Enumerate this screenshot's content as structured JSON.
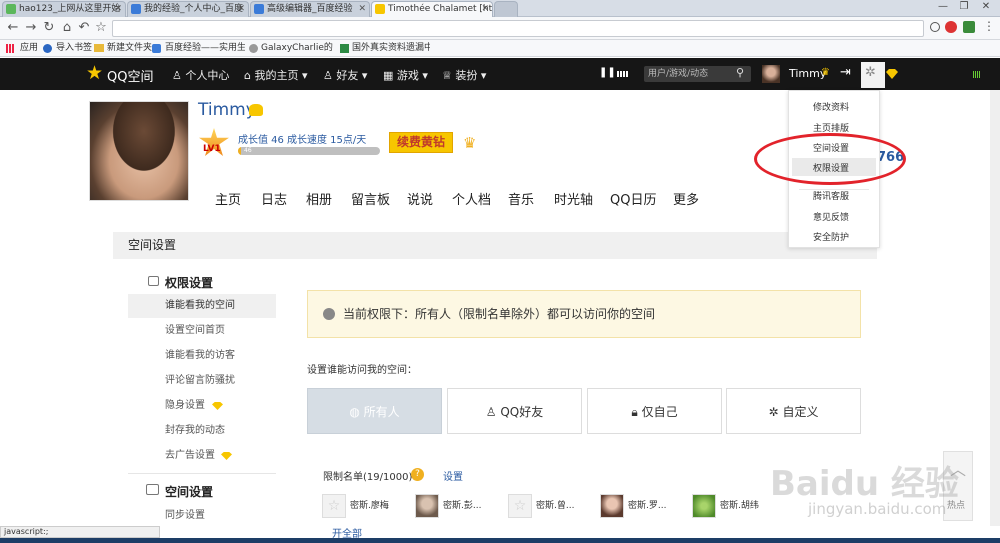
{
  "browser": {
    "tabs": [
      {
        "title": "hao123_上网从这里开始"
      },
      {
        "title": "我的经验_个人中心_百度"
      },
      {
        "title": "高级编辑器_百度经验"
      },
      {
        "title": "Timothée Chalamet [htt"
      }
    ],
    "window_controls": [
      "—",
      "❐",
      "✕"
    ],
    "nav": {
      "back": "←",
      "forward": "→",
      "reload": "↻",
      "home": "⌂",
      "undo": "↶",
      "star": "☆"
    },
    "bookmarks": [
      {
        "label": "应用"
      },
      {
        "label": "导入书签"
      },
      {
        "label": "新建文件夹"
      },
      {
        "label": "百度经验——实用生"
      },
      {
        "label": "GalaxyCharlie的个人"
      },
      {
        "label": "国外真实资料遗漏中"
      }
    ],
    "status_text": "javascript:;"
  },
  "qq": {
    "logo_text": "QQ空间",
    "nav": [
      {
        "label": "个人中心"
      },
      {
        "label": "我的主页"
      },
      {
        "label": "好友"
      },
      {
        "label": "游戏"
      },
      {
        "label": "装扮"
      }
    ],
    "search_placeholder": "用户/游戏/动态",
    "username": "Timmy",
    "accent": "#f7c600"
  },
  "profile": {
    "name": "Timmy",
    "level": "LV1",
    "growth": "成长值 46",
    "speed": "成长速度 15点/天",
    "progress_text": "46",
    "progress": 0.02,
    "vip_button": "续费黄钻",
    "visitor_count": "766"
  },
  "subnav": [
    "主页",
    "日志",
    "相册",
    "留言板",
    "说说",
    "个人档",
    "音乐",
    "时光轴",
    "QQ日历",
    "更多"
  ],
  "dropdown": [
    "修改资料",
    "主页排版",
    "空间设置",
    "权限设置",
    "腾讯客服",
    "意见反馈",
    "安全防护"
  ],
  "settings": {
    "header": "空间设置",
    "section1": "权限设置",
    "side_items": [
      "谁能看我的空间",
      "设置空间首页",
      "谁能看我的访客",
      "评论留言防骚扰",
      "隐身设置",
      "封存我的动态",
      "去广告设置"
    ],
    "section2": "空间设置",
    "side_items2": [
      "同步设置"
    ],
    "notice": "当前权限下：所有人（限制名单除外）都可以访问你的空间",
    "prompt": "设置谁能访问我的空间：",
    "options": [
      "所有人",
      "QQ好友",
      "仅自己",
      "自定义"
    ],
    "restrict_label": "限制名单(19/1000)",
    "restrict_link": "设置",
    "restrict_people": [
      "密斯.廖梅",
      "密斯.彭...",
      "密斯.曾...",
      "密斯.罗...",
      "密斯.胡纬"
    ],
    "open_all": "开全部"
  },
  "widget": {
    "hot": "热点"
  },
  "watermark": {
    "text": "Baidu 经验",
    "sub": "jingyan.baidu.com"
  }
}
